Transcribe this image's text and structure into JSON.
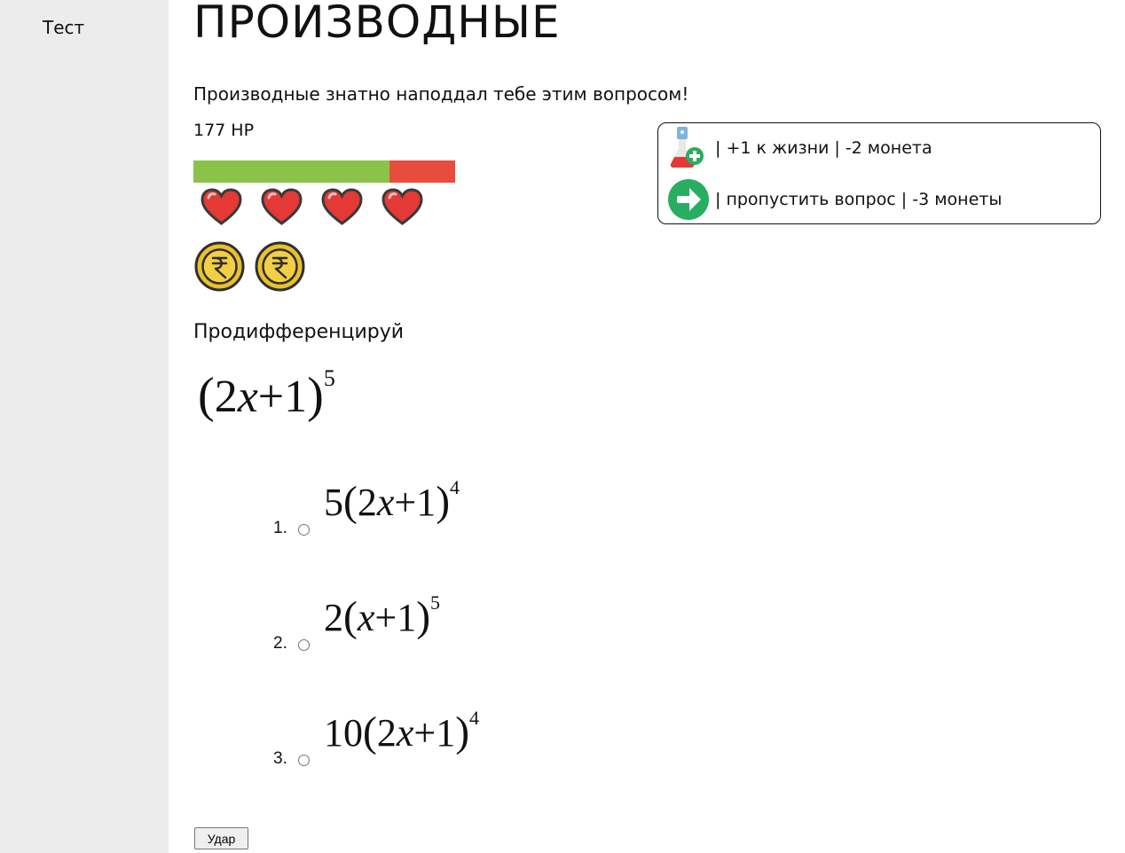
{
  "sidebar": {
    "link_label": "Тест"
  },
  "page": {
    "title": "ПРОИЗВОДНЫЕ",
    "subtitle": "Производные знатно наподдал тебе этим вопросом!"
  },
  "player": {
    "hp_label": "177 HP",
    "hp_fraction": 0.75,
    "hearts": 4,
    "coins": 2
  },
  "shop": {
    "items": [
      {
        "icon": "potion-plus-icon",
        "label": "| +1 к жизни | -2 монета"
      },
      {
        "icon": "arrow-right-icon",
        "label": "| пропустить вопрос | -3 монеты"
      }
    ]
  },
  "question": {
    "prompt": "Продифференцируй",
    "formula": {
      "coef": "",
      "open": "(",
      "inner_a": "2",
      "var": "x",
      "plus": "+",
      "inner_b": "1",
      "close": ")",
      "exp": "5"
    }
  },
  "options": [
    {
      "number": "1.",
      "coef": "5",
      "open": "(",
      "inner_a": "2",
      "var": "x",
      "plus": "+",
      "inner_b": "1",
      "close": ")",
      "exp": "4"
    },
    {
      "number": "2.",
      "coef": "2",
      "open": "(",
      "inner_a": "",
      "var": "x",
      "plus": "+",
      "inner_b": "1",
      "close": ")",
      "exp": "5"
    },
    {
      "number": "3.",
      "coef": "10",
      "open": "(",
      "inner_a": "2",
      "var": "x",
      "plus": "+",
      "inner_b": "1",
      "close": ")",
      "exp": "4"
    }
  ],
  "submit_label": "Удар",
  "colors": {
    "sidebar_bg": "#ececec",
    "hp_green": "#8bc34a",
    "hp_red": "#e84c3d",
    "heart": "#e53935",
    "coin": "#e9c02f",
    "arrow_green": "#27ae60"
  }
}
